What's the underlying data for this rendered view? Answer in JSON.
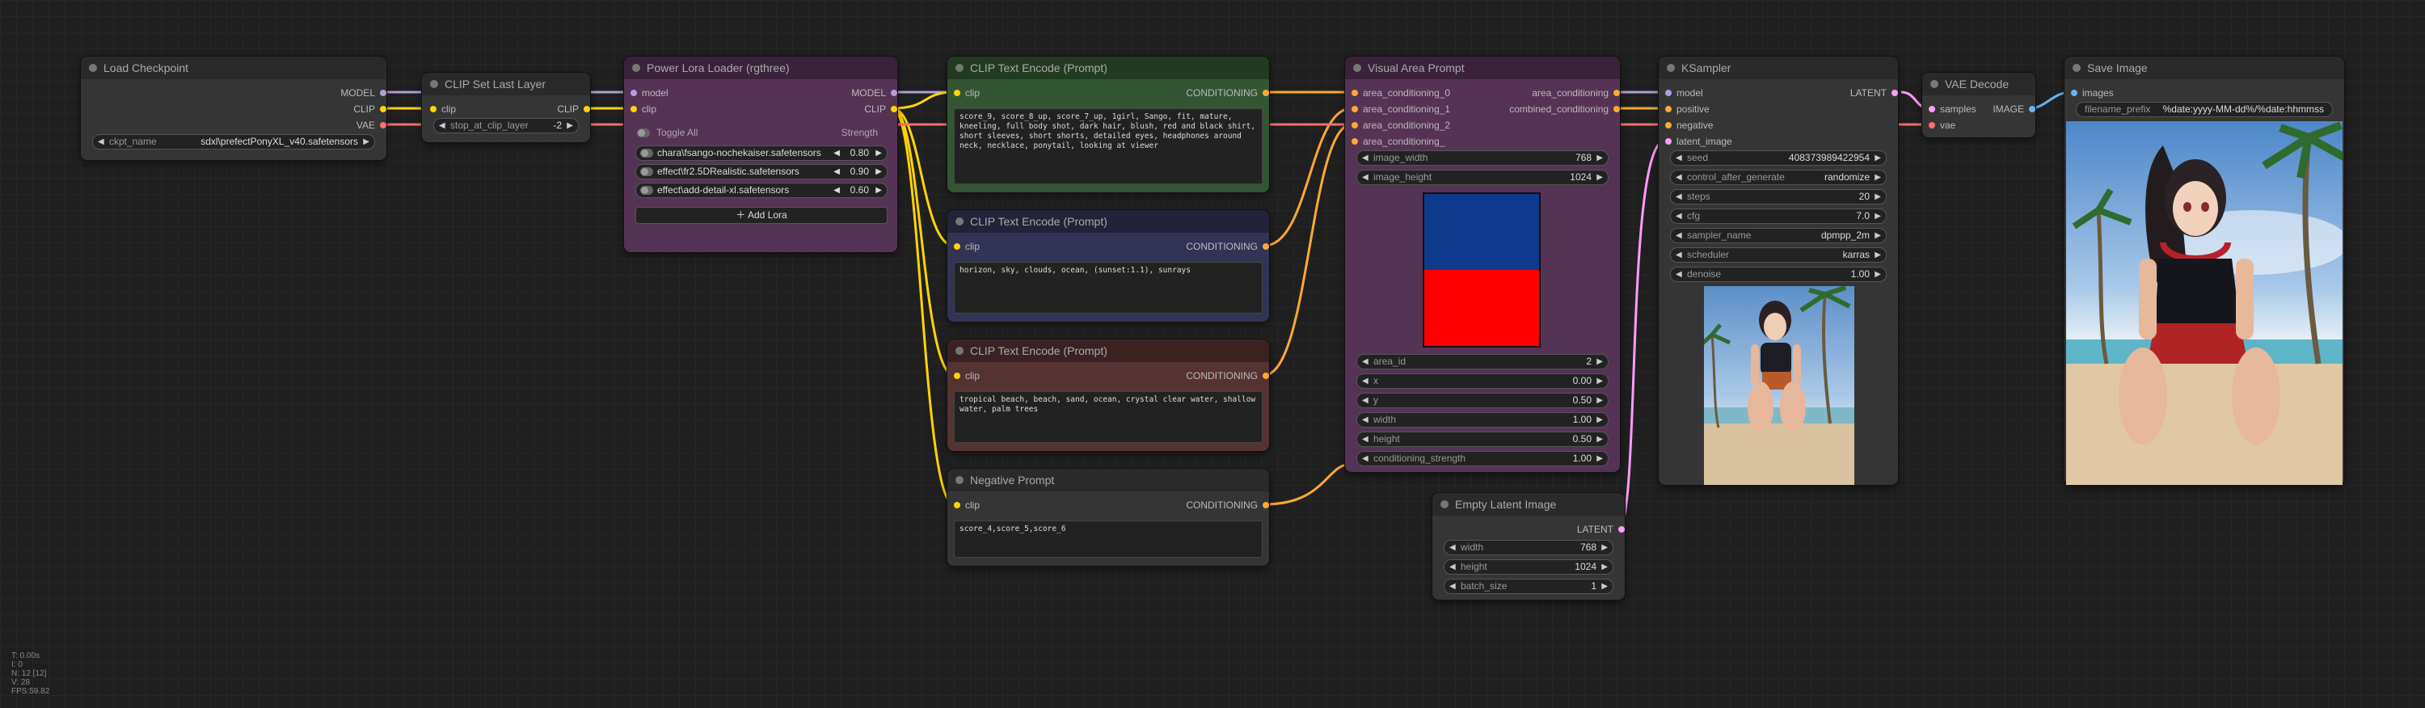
{
  "colors": {
    "model": "#b39ddb",
    "clip": "#ffd500",
    "vae": "#ff6e6e",
    "conditioning": "#ffa931",
    "latent": "#ff9cf9",
    "image": "#64b5f6"
  },
  "load_checkpoint": {
    "title": "Load Checkpoint",
    "outputs": {
      "model": "MODEL",
      "clip": "CLIP",
      "vae": "VAE"
    },
    "ckpt_name": {
      "label": "ckpt_name",
      "value": "sdxl\\prefectPonyXL_v40.safetensors"
    }
  },
  "clip_set_last_layer": {
    "title": "CLIP Set Last Layer",
    "input_clip": "clip",
    "output_clip": "CLIP",
    "stop_at_clip_layer": {
      "label": "stop_at_clip_layer",
      "value": "-2"
    }
  },
  "power_lora": {
    "title": "Power Lora Loader (rgthree)",
    "inputs": {
      "model": "model",
      "clip": "clip"
    },
    "outputs": {
      "model": "MODEL",
      "clip": "CLIP"
    },
    "toggle_all": "Toggle All",
    "strength_header": "Strength",
    "loras": [
      {
        "name": "chara\\fsango-nochekaiser.safetensors",
        "strength": "0.80"
      },
      {
        "name": "effect\\fr2.5DRealistic.safetensors",
        "strength": "0.90"
      },
      {
        "name": "effect\\add-detail-xl.safetensors",
        "strength": "0.60"
      }
    ],
    "add_lora": "＋ Add Lora"
  },
  "clip_text_1": {
    "title": "CLIP Text Encode (Prompt)",
    "input": "clip",
    "output": "CONDITIONING",
    "text": "score_9, score_8_up, score_7_up, 1girl, Sango, fit, mature, kneeling, full body shot, dark hair, blush, red and black shirt, short sleeves, short shorts, detailed eyes, headphones around neck, necklace, ponytail, looking at viewer"
  },
  "clip_text_2": {
    "title": "CLIP Text Encode (Prompt)",
    "input": "clip",
    "output": "CONDITIONING",
    "text": "horizon, sky, clouds, ocean, (sunset:1.1), sunrays"
  },
  "clip_text_3": {
    "title": "CLIP Text Encode (Prompt)",
    "input": "clip",
    "output": "CONDITIONING",
    "text": "tropical beach, beach, sand, ocean, crystal clear water, shallow water, palm trees"
  },
  "negative_prompt": {
    "title": "Negative Prompt",
    "input": "clip",
    "output": "CONDITIONING",
    "text": "score_4,score_5,score_6"
  },
  "visual_area": {
    "title": "Visual Area Prompt",
    "inputs": [
      "area_conditioning_0",
      "area_conditioning_1",
      "area_conditioning_2",
      "area_conditioning_"
    ],
    "outputs": {
      "area": "area_conditioning",
      "combined": "combined_conditioning"
    },
    "image_width": {
      "label": "image_width",
      "value": "768"
    },
    "image_height": {
      "label": "image_height",
      "value": "1024"
    },
    "area_id": {
      "label": "area_id",
      "value": "2"
    },
    "x": {
      "label": "x",
      "value": "0.00"
    },
    "y": {
      "label": "y",
      "value": "0.50"
    },
    "width": {
      "label": "width",
      "value": "1.00"
    },
    "height": {
      "label": "height",
      "value": "0.50"
    },
    "conditioning_strength": {
      "label": "conditioning_strength",
      "value": "1.00"
    },
    "preview_colors": {
      "top": "#0d3a8a",
      "bottom": "#ff0000"
    }
  },
  "ksampler": {
    "title": "KSampler",
    "inputs": [
      "model",
      "positive",
      "negative",
      "latent_image"
    ],
    "output": "LATENT",
    "widgets": [
      {
        "label": "seed",
        "value": "408373989422954"
      },
      {
        "label": "control_after_generate",
        "value": "randomize"
      },
      {
        "label": "steps",
        "value": "20"
      },
      {
        "label": "cfg",
        "value": "7.0"
      },
      {
        "label": "sampler_name",
        "value": "dpmpp_2m"
      },
      {
        "label": "scheduler",
        "value": "karras"
      },
      {
        "label": "denoise",
        "value": "1.00"
      }
    ]
  },
  "vae_decode": {
    "title": "VAE Decode",
    "inputs": {
      "samples": "samples",
      "vae": "vae"
    },
    "output": "IMAGE"
  },
  "save_image": {
    "title": "Save Image",
    "input": "images",
    "filename_prefix": {
      "label": "filename_prefix",
      "value": "%date:yyyy-MM-dd%/%date:hhmmss"
    }
  },
  "empty_latent": {
    "title": "Empty Latent Image",
    "output": "LATENT",
    "width": {
      "label": "width",
      "value": "768"
    },
    "height": {
      "label": "height",
      "value": "1024"
    },
    "batch_size": {
      "label": "batch_size",
      "value": "1"
    }
  },
  "stats": {
    "t": "T: 0.00s",
    "i": "I: 0",
    "n": "N: 12 [12]",
    "v": "V: 28",
    "fps": "FPS:59.82"
  }
}
